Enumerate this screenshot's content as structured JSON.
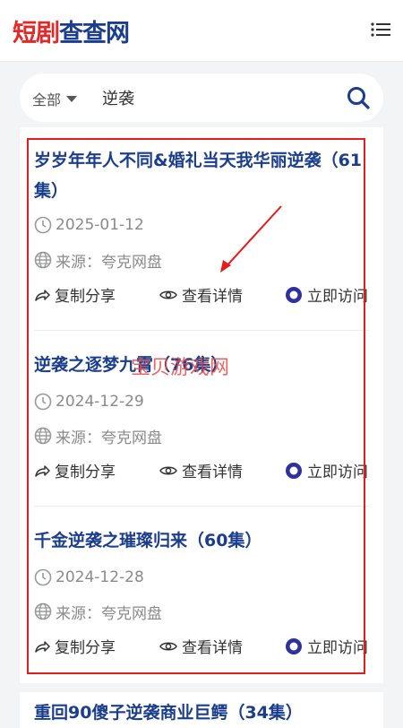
{
  "header": {
    "logo_part1": "短剧",
    "logo_part2": "查查网",
    "menu_icon": "menu-icon"
  },
  "search": {
    "filter_label": "全部",
    "query": "逆袭",
    "search_icon": "search-icon"
  },
  "actions": {
    "copy": "复制分享",
    "view": "查看详情",
    "visit": "立即访问"
  },
  "items": [
    {
      "title": "岁岁年年人不同&婚礼当天我华丽逆袭（61集）",
      "date": "2025-01-12",
      "source": "来源：夸克网盘"
    },
    {
      "title": "逆袭之逐梦九霄（76集）",
      "date": "2024-12-29",
      "source": "来源：夸克网盘"
    },
    {
      "title": "千金逆袭之璀璨归来（60集）",
      "date": "2024-12-28",
      "source": "来源：夸克网盘"
    },
    {
      "title": "重回90傻子逆袭商业巨鳄（34集）"
    }
  ],
  "watermark": "宝贝游戏网",
  "colors": {
    "title_blue": "#1b3e8c",
    "logo_red": "#e02a2a",
    "highlight_red": "#e31c1c"
  }
}
